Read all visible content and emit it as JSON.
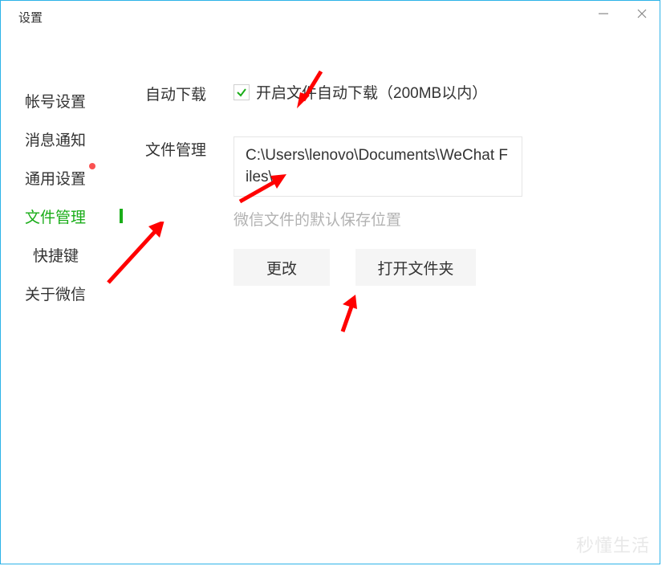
{
  "window": {
    "title": "设置"
  },
  "sidebar": {
    "items": [
      {
        "label": "帐号设置",
        "active": false,
        "dot": false
      },
      {
        "label": "消息通知",
        "active": false,
        "dot": false
      },
      {
        "label": "通用设置",
        "active": false,
        "dot": true
      },
      {
        "label": "文件管理",
        "active": true,
        "dot": false
      },
      {
        "label": "快捷键",
        "active": false,
        "dot": false,
        "indent": true
      },
      {
        "label": "关于微信",
        "active": false,
        "dot": false
      }
    ]
  },
  "main": {
    "auto_download": {
      "section_label": "自动下载",
      "checked": true,
      "label": "开启文件自动下载（200MB以内）"
    },
    "file_manage": {
      "section_label": "文件管理",
      "path": "C:\\Users\\lenovo\\Documents\\WeChat Files\\",
      "hint": "微信文件的默认保存位置",
      "change_button": "更改",
      "open_button": "打开文件夹"
    }
  },
  "watermark": {
    "primary": "秒懂生活"
  },
  "colors": {
    "accent": "#1aad19",
    "border": "#2db3e8",
    "arrow": "#ff0000",
    "dot": "#fa5151"
  }
}
